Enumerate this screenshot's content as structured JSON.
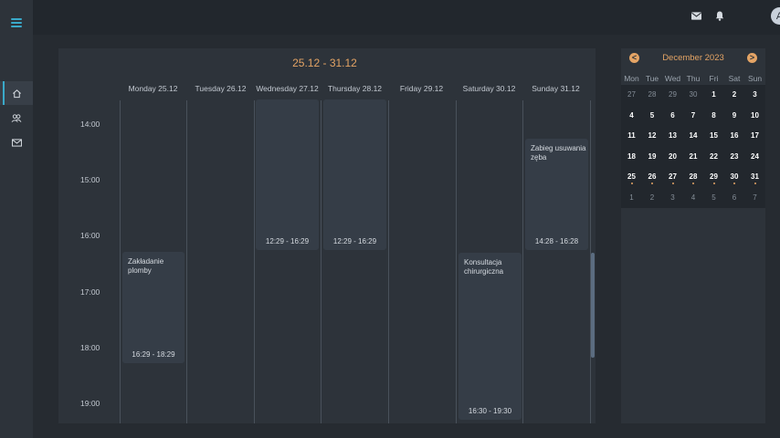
{
  "nav": {
    "menu_icon": "hamburger-icon",
    "items": [
      {
        "icon": "home-icon",
        "active": true
      },
      {
        "icon": "users-icon",
        "active": false
      },
      {
        "icon": "mail-icon",
        "active": false
      }
    ]
  },
  "topbar": {
    "icons": [
      "mail-icon",
      "bell-icon"
    ],
    "avatar_letter": "A"
  },
  "week": {
    "range": "25.12 - 31.12",
    "days": [
      "Monday 25.12",
      "Tuesday 26.12",
      "Wednesday 27.12",
      "Thursday 28.12",
      "Friday 29.12",
      "Saturday 30.12",
      "Sunday 31.12"
    ],
    "times": [
      "14:00",
      "15:00",
      "16:00",
      "17:00",
      "18:00",
      "19:00"
    ],
    "events": [
      {
        "day": 0,
        "title": "Zakładanie plomby",
        "time": "16:29 - 18:29"
      },
      {
        "day": 2,
        "title": "",
        "time": "12:29 - 16:29"
      },
      {
        "day": 3,
        "title": "",
        "time": "12:29 - 16:29"
      },
      {
        "day": 5,
        "title": "Konsultacja chirurgiczna",
        "time": "16:30 - 19:30"
      },
      {
        "day": 6,
        "title": "Zabieg usuwania zęba",
        "time": "14:28 - 16:28"
      }
    ]
  },
  "month": {
    "title": "December 2023",
    "prev_label": "<",
    "next_label": ">",
    "weekdays": [
      "Mon",
      "Tue",
      "Wed",
      "Thu",
      "Fri",
      "Sat",
      "Sun"
    ],
    "weeks": [
      [
        {
          "d": "27",
          "c": false
        },
        {
          "d": "28",
          "c": false
        },
        {
          "d": "29",
          "c": false
        },
        {
          "d": "30",
          "c": false
        },
        {
          "d": "1",
          "c": true
        },
        {
          "d": "2",
          "c": true
        },
        {
          "d": "3",
          "c": true
        }
      ],
      [
        {
          "d": "4",
          "c": true
        },
        {
          "d": "5",
          "c": true
        },
        {
          "d": "6",
          "c": true
        },
        {
          "d": "7",
          "c": true
        },
        {
          "d": "8",
          "c": true
        },
        {
          "d": "9",
          "c": true
        },
        {
          "d": "10",
          "c": true
        }
      ],
      [
        {
          "d": "11",
          "c": true
        },
        {
          "d": "12",
          "c": true
        },
        {
          "d": "13",
          "c": true
        },
        {
          "d": "14",
          "c": true
        },
        {
          "d": "15",
          "c": true
        },
        {
          "d": "16",
          "c": true
        },
        {
          "d": "17",
          "c": true
        }
      ],
      [
        {
          "d": "18",
          "c": true
        },
        {
          "d": "19",
          "c": true
        },
        {
          "d": "20",
          "c": true
        },
        {
          "d": "21",
          "c": true
        },
        {
          "d": "22",
          "c": true
        },
        {
          "d": "23",
          "c": true
        },
        {
          "d": "24",
          "c": true
        }
      ],
      [
        {
          "d": "25",
          "c": true,
          "e": true
        },
        {
          "d": "26",
          "c": true,
          "e": true
        },
        {
          "d": "27",
          "c": true,
          "e": true
        },
        {
          "d": "28",
          "c": true,
          "e": true
        },
        {
          "d": "29",
          "c": true,
          "e": true
        },
        {
          "d": "30",
          "c": true,
          "e": true
        },
        {
          "d": "31",
          "c": true,
          "e": true
        }
      ],
      [
        {
          "d": "1",
          "c": false
        },
        {
          "d": "2",
          "c": false
        },
        {
          "d": "3",
          "c": false
        },
        {
          "d": "4",
          "c": false
        },
        {
          "d": "5",
          "c": false
        },
        {
          "d": "6",
          "c": false
        },
        {
          "d": "7",
          "c": false
        }
      ]
    ]
  },
  "colors": {
    "accent": "#e4a465",
    "active_nav": "#3aa9c9",
    "background": "#262b31",
    "panel": "#2d333a",
    "event": "#353d47"
  }
}
